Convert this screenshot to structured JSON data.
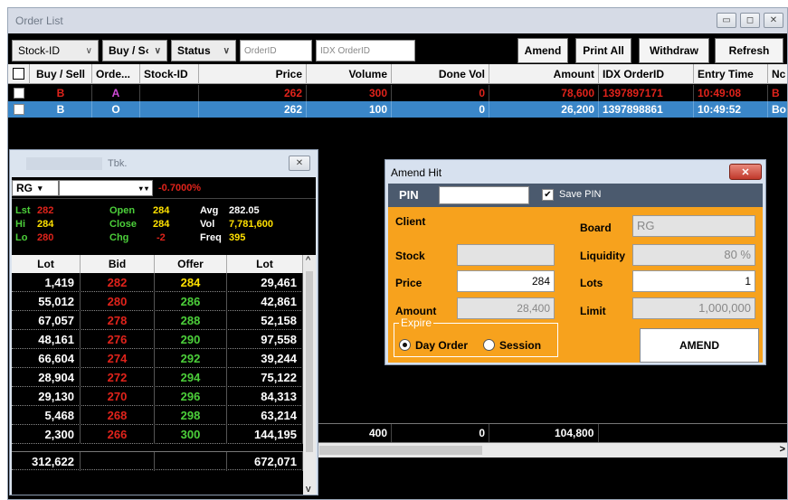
{
  "window": {
    "title": "Order List",
    "btn_min": "▭",
    "btn_max": "◻",
    "btn_close": "✕"
  },
  "toolbar": {
    "stock_select": "Stock-ID",
    "buysell_select": "Buy / S‹",
    "status_select": "Status",
    "orderid_placeholder": "OrderID",
    "idx_placeholder": "IDX OrderID",
    "amend_label": "Amend",
    "printall_label": "Print All",
    "withdraw_label": "Withdraw",
    "refresh_label": "Refresh"
  },
  "grid": {
    "columns": [
      "Buy / Sell",
      "Orde...",
      "Stock-ID",
      "Price",
      "Volume",
      "Done Vol",
      "Amount",
      "IDX OrderID",
      "Entry Time",
      "Nc"
    ],
    "rows": [
      {
        "side": "B",
        "ord": "A",
        "stock": "",
        "price": "262",
        "volume": "300",
        "done": "0",
        "amount": "78,600",
        "idx": "1397897171",
        "time": "10:49:08",
        "extra": "B"
      },
      {
        "side": "B",
        "ord": "O",
        "stock": "",
        "price": "262",
        "volume": "100",
        "done": "0",
        "amount": "26,200",
        "idx": "1397898861",
        "time": "10:49:52",
        "extra": "Bo"
      }
    ],
    "totals": {
      "volume": "400",
      "done": "0",
      "amount": "104,800"
    },
    "scroll_right": ">"
  },
  "depth": {
    "title": "Tbk.",
    "close": "✕",
    "board": "RG",
    "board_arrow": "▾",
    "stock_arrow": "▾ ▾",
    "change_pct": "-0.7000%",
    "stats": {
      "lst_label": "Lst",
      "lst": "282",
      "hi_label": "Hi",
      "hi": "284",
      "lo_label": "Lo",
      "lo": "280",
      "open_label": "Open",
      "open": "284",
      "close_label": "Close",
      "close": "284",
      "chg_label": "Chg",
      "chg": "-2",
      "avg_label": "Avg",
      "avg": "282.05",
      "vol_label": "Vol",
      "vol": "7,781,600",
      "freq_label": "Freq",
      "freq": "395"
    },
    "columns": [
      "Lot",
      "Bid",
      "Offer",
      "Lot"
    ],
    "rows": [
      {
        "bidlot": "1,419",
        "bid": "282",
        "offer": "284",
        "offlot": "29,461"
      },
      {
        "bidlot": "55,012",
        "bid": "280",
        "offer": "286",
        "offlot": "42,861"
      },
      {
        "bidlot": "67,057",
        "bid": "278",
        "offer": "288",
        "offlot": "52,158"
      },
      {
        "bidlot": "48,161",
        "bid": "276",
        "offer": "290",
        "offlot": "97,558"
      },
      {
        "bidlot": "66,604",
        "bid": "274",
        "offer": "292",
        "offlot": "39,244"
      },
      {
        "bidlot": "28,904",
        "bid": "272",
        "offer": "294",
        "offlot": "75,122"
      },
      {
        "bidlot": "29,130",
        "bid": "270",
        "offer": "296",
        "offlot": "84,313"
      },
      {
        "bidlot": "5,468",
        "bid": "268",
        "offer": "298",
        "offlot": "63,214"
      },
      {
        "bidlot": "2,300",
        "bid": "266",
        "offer": "300",
        "offlot": "144,195"
      }
    ],
    "totals": {
      "bidlot": "312,622",
      "offlot": "672,071"
    },
    "scroll_up": "^",
    "scroll_down": "v"
  },
  "amend": {
    "title": "Amend Hit",
    "close": "✕",
    "pin_label": "PIN",
    "save_pin_label": "Save PIN",
    "save_pin_check": "✔",
    "client_label": "Client",
    "board_label": "Board",
    "board_value": "RG",
    "stock_label": "Stock",
    "liquidity_label": "Liquidity",
    "liquidity_value": "80 %",
    "price_label": "Price",
    "price_value": "284",
    "lots_label": "Lots",
    "lots_value": "1",
    "amount_label": "Amount",
    "amount_value": "28,400",
    "limit_label": "Limit",
    "limit_value": "1,000,000",
    "expire_label": "Expire",
    "day_order_label": "Day Order",
    "session_label": "Session",
    "amend_button": "AMEND"
  },
  "colors": {
    "buy_red": "#e0231b",
    "up_yellow": "#ffe100",
    "offer_green": "#4ccf3a",
    "selected_blue": "#3a86c8",
    "amend_orange": "#f7a21d"
  }
}
